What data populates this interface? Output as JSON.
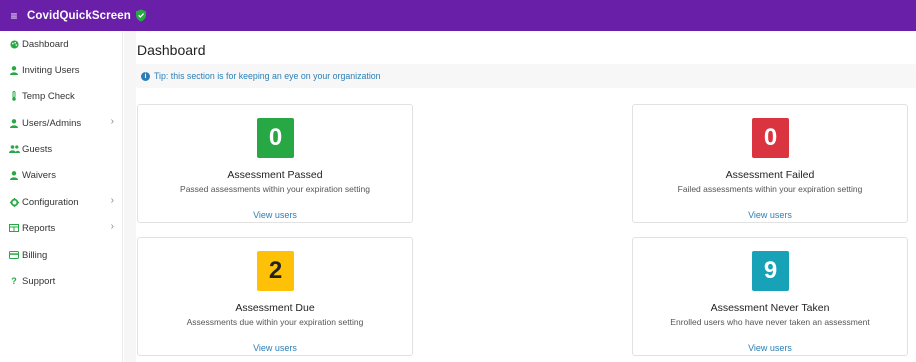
{
  "app": {
    "title": "CovidQuickScreen",
    "hamburger_glyph": "≡"
  },
  "sidebar": {
    "items": [
      {
        "label": "Dashboard",
        "icon": "palette-icon",
        "has_chevron": false
      },
      {
        "label": "Inviting Users",
        "icon": "user-icon",
        "has_chevron": false
      },
      {
        "label": "Temp Check",
        "icon": "thermometer-icon",
        "has_chevron": false
      },
      {
        "label": "Users/Admins",
        "icon": "user-icon",
        "has_chevron": true
      },
      {
        "label": "Guests",
        "icon": "users-icon",
        "has_chevron": false
      },
      {
        "label": "Waivers",
        "icon": "user-icon",
        "has_chevron": false
      },
      {
        "label": "Configuration",
        "icon": "gear-icon",
        "has_chevron": true
      },
      {
        "label": "Reports",
        "icon": "table-icon",
        "has_chevron": true
      },
      {
        "label": "Billing",
        "icon": "credit-card-icon",
        "has_chevron": false
      },
      {
        "label": "Support",
        "icon": "question-icon",
        "has_chevron": false
      }
    ],
    "chevron_glyph": "›"
  },
  "main": {
    "title": "Dashboard",
    "tip": "Tip: this section is for keeping an eye on your organization",
    "tip_icon_glyph": "i"
  },
  "cards": [
    {
      "count": "0",
      "title": "Assessment Passed",
      "subtitle": "Passed assessments within your expiration setting",
      "link": "View users",
      "color": "#28a745",
      "text_color": "#ffffff"
    },
    {
      "count": "0",
      "title": "Assessment Failed",
      "subtitle": "Failed assessments within your expiration setting",
      "link": "View users",
      "color": "#d9343f",
      "text_color": "#ffffff"
    },
    {
      "count": "2",
      "title": "Assessment Due",
      "subtitle": "Assessments due within your expiration setting",
      "link": "View users",
      "color": "#ffc107",
      "text_color": "#222222"
    },
    {
      "count": "9",
      "title": "Assessment Never Taken",
      "subtitle": "Enrolled users who have never taken an assessment",
      "link": "View users",
      "color": "#17a2b8",
      "text_color": "#ffffff"
    }
  ],
  "colors": {
    "topbar": "#6a1fa8",
    "accent_green": "#28a745",
    "link_blue": "#2b7fb6"
  }
}
